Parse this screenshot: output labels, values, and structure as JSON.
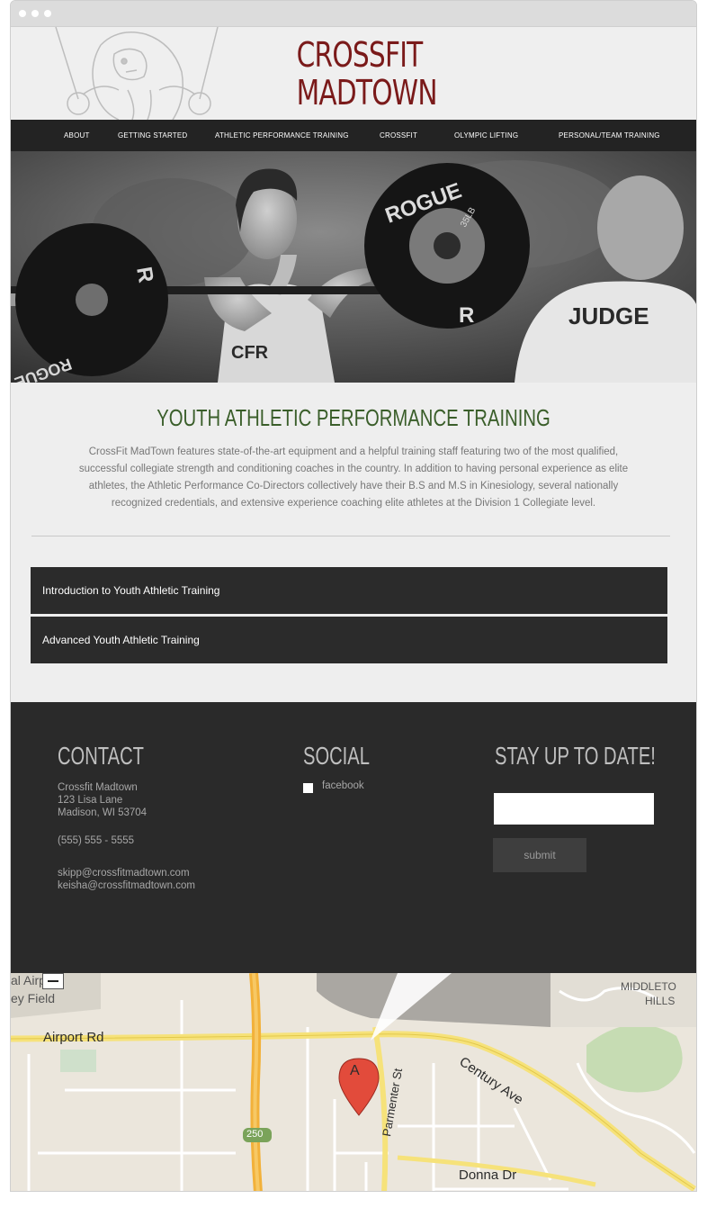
{
  "brand": {
    "line1": "CROSSFIT",
    "line2": "MADTOWN",
    "color": "#7a1a1a"
  },
  "nav": {
    "items": [
      {
        "label": "ABOUT"
      },
      {
        "label": "GETTING STARTED"
      },
      {
        "label": "ATHLETIC PERFORMANCE TRAINING"
      },
      {
        "label": "CROSSFIT"
      },
      {
        "label": "OLYMPIC LIFTING"
      },
      {
        "label": "PERSONAL/TEAM TRAINING"
      }
    ]
  },
  "hero": {
    "plate_text_left": "ROGUE",
    "plate_text_right": "ROGUE",
    "plate_weight": "35LB",
    "shirt_text": "JUDGE",
    "shirt_text_left": "CFR"
  },
  "main": {
    "title": "YOUTH ATHLETIC PERFORMANCE TRAINING",
    "title_color": "#3a5e2a",
    "intro": "CrossFit MadTown features state-of-the-art equipment and a helpful training staff featuring two of the most qualified, successful collegiate strength and conditioning coaches in the country. In addition to having personal experience as elite athletes, the Athletic Performance Co-Directors collectively have their B.S and M.S in Kinesiology, several nationally recognized credentials, and extensive experience coaching elite athletes at the Division 1 Collegiate level.",
    "accordion": [
      {
        "label": "Introduction to Youth Athletic Training"
      },
      {
        "label": "Advanced Youth Athletic Training"
      }
    ]
  },
  "footer": {
    "contact": {
      "heading": "CONTACT",
      "name": "Crossfit Madtown",
      "street": "123 Lisa Lane",
      "city": "Madison, WI 53704",
      "phone": "(555) 555 - 5555",
      "email1": "skipp@crossfitmadtown.com",
      "email2": "keisha@crossfitmadtown.com"
    },
    "social": {
      "heading": "SOCIAL",
      "facebook_label": "facebook"
    },
    "newsletter": {
      "heading": "STAY UP TO DATE!",
      "input_value": "",
      "submit_label": "submit"
    }
  },
  "map": {
    "labels": {
      "airport_rd": "Airport Rd",
      "century_ave": "Century Ave",
      "parmenter_st": "Parmenter St",
      "donna_dr": "Donna Dr",
      "middleton": "MIDDLETO",
      "hills": "HILLS",
      "airport_partial": "al Airport",
      "field_partial": "ey Field",
      "route_250": "250",
      "marker": "A"
    }
  }
}
